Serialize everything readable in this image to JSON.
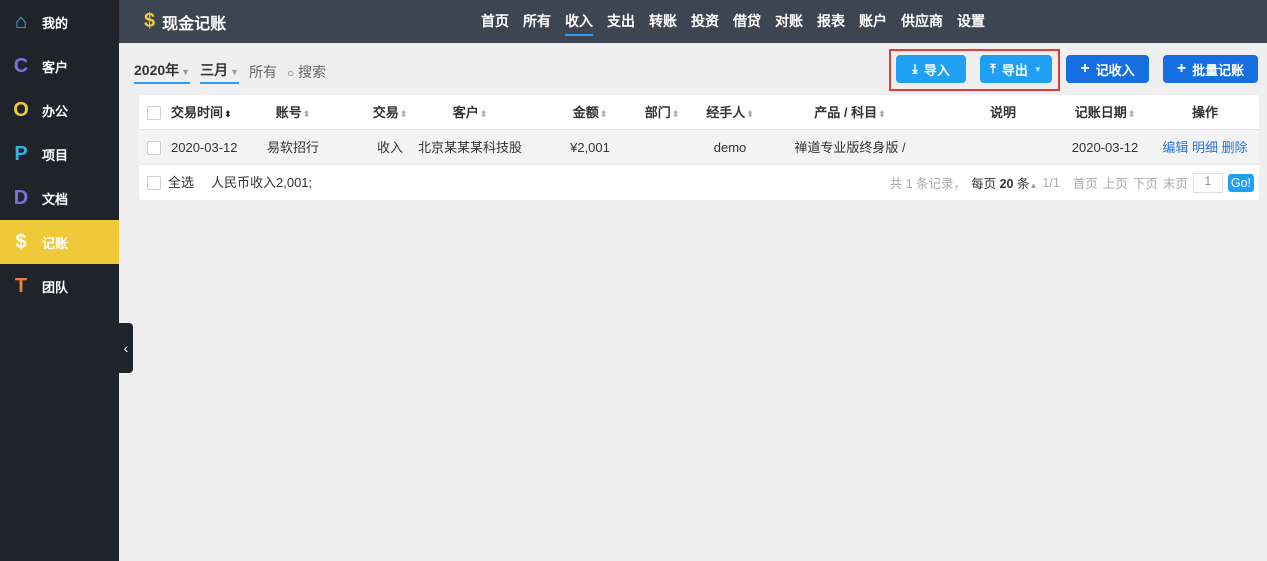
{
  "sidebar": {
    "items": [
      {
        "label": "我的",
        "icon": "home-icon",
        "glyph": "⌂",
        "color": "#4fb3e8"
      },
      {
        "label": "客户",
        "icon": "letter-c-icon",
        "glyph": "C",
        "color": "#7b6fe0"
      },
      {
        "label": "办公",
        "icon": "letter-o-icon",
        "glyph": "O",
        "color": "#f0c93b"
      },
      {
        "label": "项目",
        "icon": "letter-p-icon",
        "glyph": "P",
        "color": "#33b4e0"
      },
      {
        "label": "文档",
        "icon": "letter-d-icon",
        "glyph": "D",
        "color": "#7b6fe0"
      },
      {
        "label": "记账",
        "icon": "dollar-icon",
        "glyph": "$",
        "color": "#ffffff"
      },
      {
        "label": "团队",
        "icon": "letter-t-icon",
        "glyph": "T",
        "color": "#f07a3b"
      }
    ],
    "active": "记账"
  },
  "header": {
    "title": "现金记账",
    "nav": [
      "首页",
      "所有",
      "收入",
      "支出",
      "转账",
      "投资",
      "借贷",
      "对账",
      "报表",
      "账户",
      "供应商",
      "设置"
    ],
    "active_nav": "收入"
  },
  "filters": {
    "year": "2020年",
    "month": "三月",
    "all": "所有",
    "search": "搜索"
  },
  "actions": {
    "import": "导入",
    "export": "导出",
    "add_income": "记收入",
    "batch": "批量记账"
  },
  "table": {
    "columns": [
      "交易时间",
      "账号",
      "交易",
      "客户",
      "金额",
      "部门",
      "经手人",
      "产品 / 科目",
      "说明",
      "记账日期",
      "操作"
    ],
    "rows": [
      {
        "date": "2020-03-12",
        "account": "易软招行",
        "type": "收入",
        "customer": "北京某某某科技股",
        "amount": "¥2,001",
        "dept": "",
        "handler": "demo",
        "product": "禅道专业版终身版 /",
        "note": "",
        "record_date": "2020-03-12",
        "ops": [
          "编辑",
          "明细",
          "删除"
        ]
      }
    ],
    "footer": {
      "select_all": "全选",
      "summary": "人民币收入2,001;"
    },
    "pager": {
      "total": "共 1 条记录，",
      "per_page_label": "每页",
      "per_page": "20",
      "unit": "条",
      "page": "1/1",
      "first": "首页",
      "prev": "上页",
      "next": "下页",
      "last": "末页",
      "input": "1",
      "go": "Go!"
    }
  }
}
